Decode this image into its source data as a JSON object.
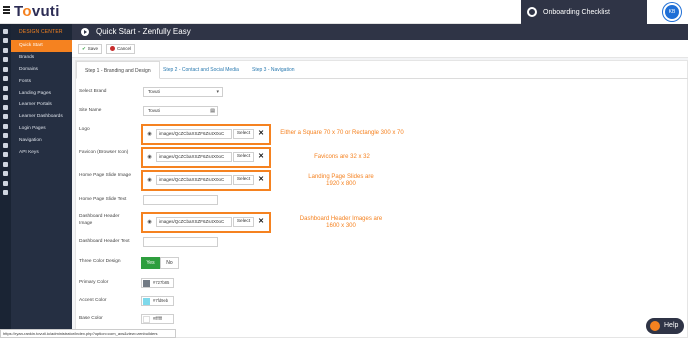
{
  "app": {
    "logo_text_prefix": "T",
    "logo_text_o": "o",
    "logo_text_suffix": "vuti"
  },
  "topbar": {
    "onboarding_label": "Onboarding Checklist",
    "avatar_initials": "KB"
  },
  "sidebar": {
    "header": "DESIGN CENTER",
    "items": [
      {
        "label": "Quick Start",
        "active": true
      },
      {
        "label": "Brands"
      },
      {
        "label": "Domains"
      },
      {
        "label": "Fonts"
      },
      {
        "label": "Landing Pages"
      },
      {
        "label": "Learner Portals"
      },
      {
        "label": "Learner Dashboards"
      },
      {
        "label": "Login Pages"
      },
      {
        "label": "Navigation"
      },
      {
        "label": "API Keys"
      }
    ]
  },
  "page": {
    "title": "Quick Start - Zenfully Easy"
  },
  "toolbar": {
    "save_label": "Save",
    "cancel_label": "Cancel"
  },
  "tabs": [
    {
      "label": "Step 1 - Branding and Design",
      "active": true
    },
    {
      "label": "Step 2 - Contact and Social Media"
    },
    {
      "label": "Step 3 - Navigation"
    }
  ],
  "form": {
    "select_brand": {
      "label": "Select Brand",
      "value": "Tovuti"
    },
    "site_name": {
      "label": "Site Name",
      "value": "Tovuti"
    },
    "logo": {
      "label": "Logo",
      "path": "images/QcZCbaXSZF6Zs4X0oC",
      "select_label": "Select",
      "note": "Either a Square 70 x 70 or Rectangle 300 x 70"
    },
    "favicon": {
      "label": "Favicon (Browser Icon)",
      "path": "images/QcZCbaXSZF6Zs4X0oC",
      "select_label": "Select",
      "note": "Favicons are 32 x 32"
    },
    "home_slide_image": {
      "label": "Home Page Slide Image",
      "path": "images/QcZCbaXSZF6Zs4X0oC",
      "select_label": "Select",
      "note_line1": "Landing Page Slides are",
      "note_line2": "1920 x 800"
    },
    "home_slide_text": {
      "label": "Home Page Slide Text",
      "value": ""
    },
    "dashboard_header_image": {
      "label_line1": "Dashboard Header",
      "label_line2": "Image",
      "path": "images/QcZCbaXSZF6Zs4X0oC",
      "select_label": "Select",
      "note_line1": "Dashboard Header Images are",
      "note_line2": "1600 x 300"
    },
    "dashboard_header_text": {
      "label": "Dashboard Header Text",
      "value": ""
    },
    "three_color_design": {
      "label": "Three Color Design",
      "yes_label": "Yes",
      "no_label": "No",
      "selected": "Yes"
    },
    "primary_color": {
      "label": "Primary Color",
      "value": "#727b85",
      "swatch": "#727b85"
    },
    "accent_color": {
      "label": "Accent Color",
      "value": "#7fd9eb",
      "swatch": "#7fd9eb"
    },
    "base_color": {
      "label": "Base Color",
      "value": "#ffffff",
      "swatch": "#ffffff"
    }
  },
  "statusbar": {
    "url": "https://ryan-rankin.tovuti.io/administrator/index.php?option=com_axs&view=zenbuilders"
  },
  "help": {
    "label": "Help"
  },
  "colors": {
    "accent_orange": "#f58220",
    "header_dark": "#2f3446",
    "sidebar_bg": "#252f42",
    "success_green": "#2e9e3e"
  }
}
